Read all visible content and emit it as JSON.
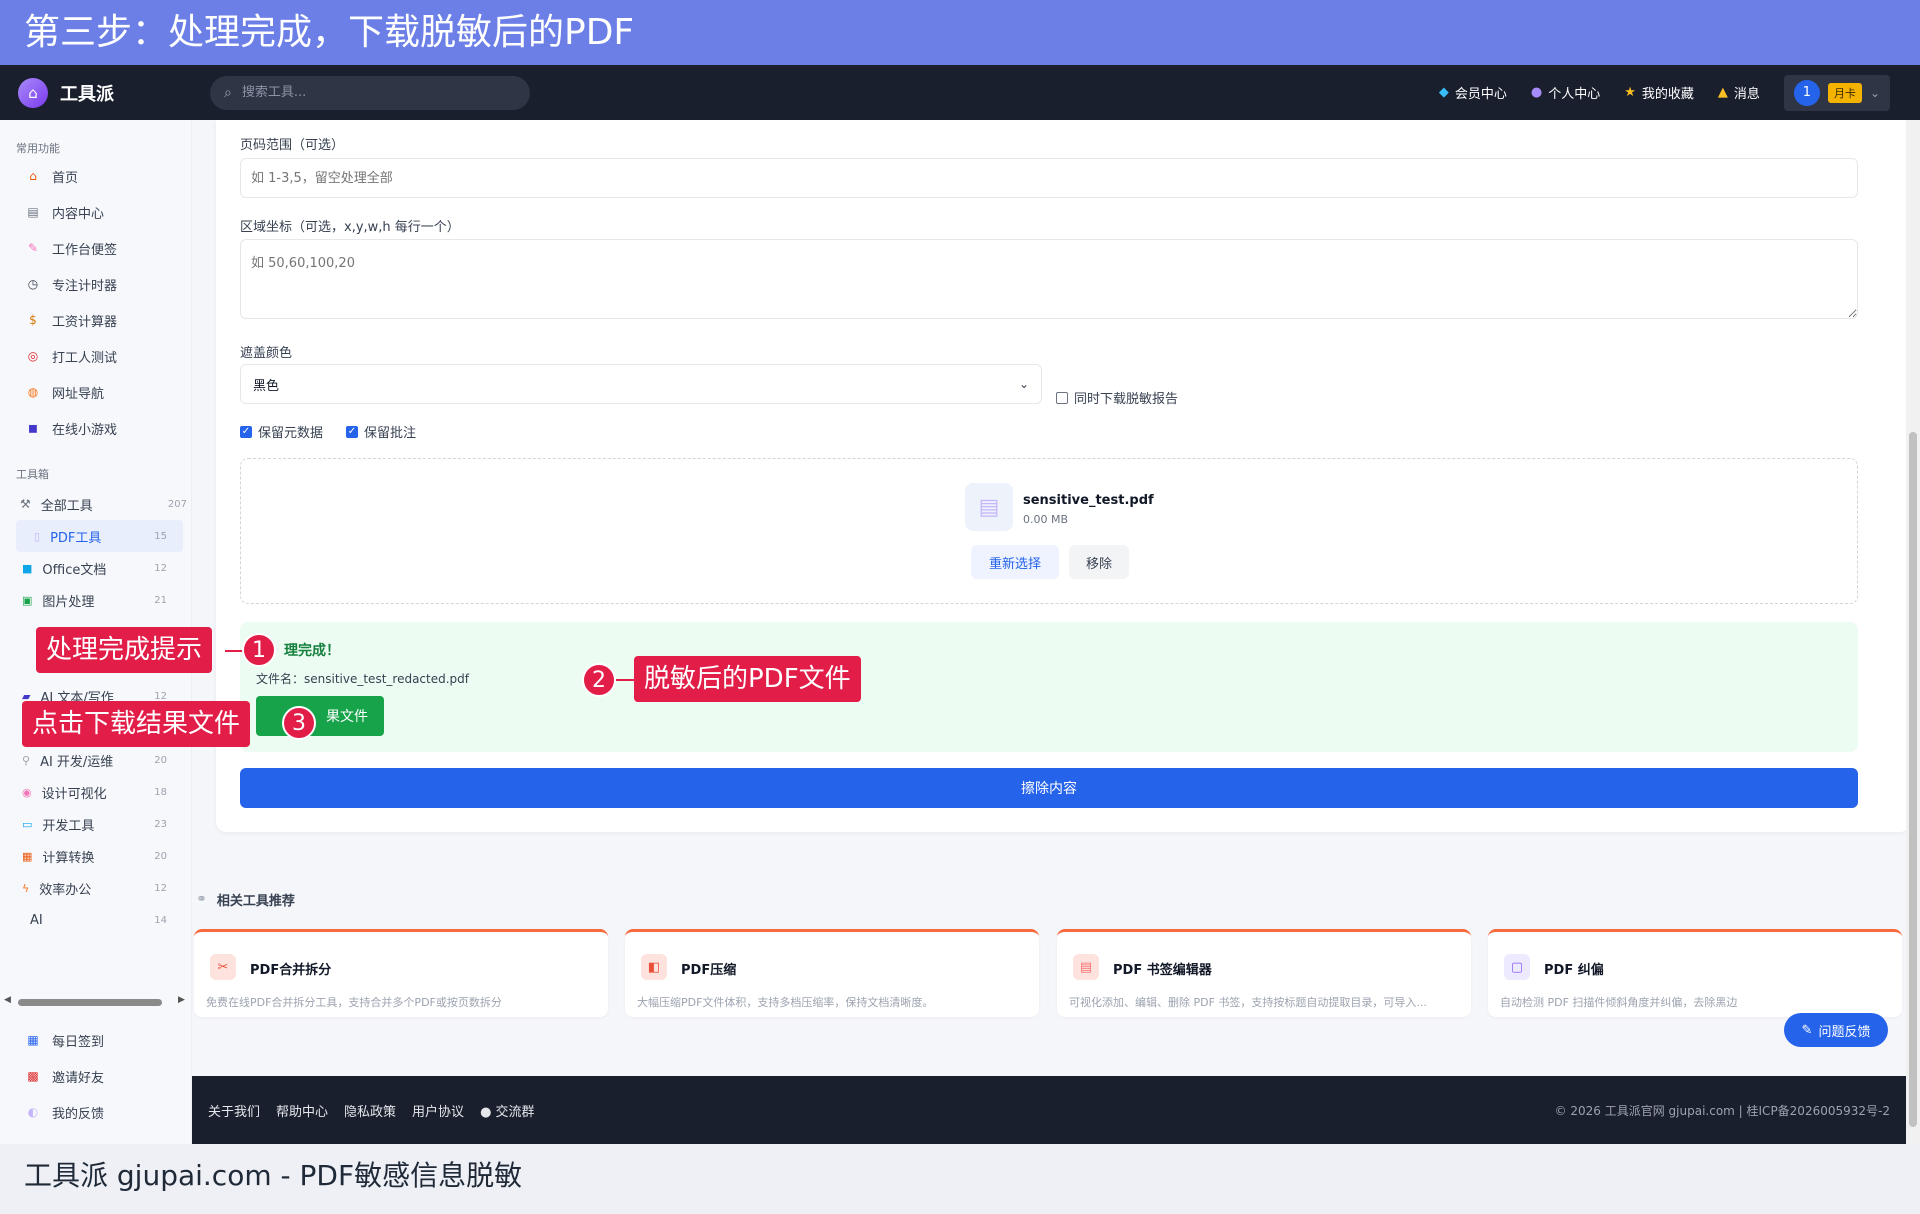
{
  "banner_top": "第三步：处理完成，下载脱敏后的PDF",
  "banner_bottom": "工具派 gjupai.com - PDF敏感信息脱敏",
  "header": {
    "logo_text": "工具派",
    "search_placeholder": "搜索工具...",
    "nav": [
      {
        "label": "会员中心",
        "icon": "diamond-icon"
      },
      {
        "label": "个人中心",
        "icon": "user-icon"
      },
      {
        "label": "我的收藏",
        "icon": "star-icon"
      },
      {
        "label": "消息",
        "icon": "bell-icon"
      }
    ],
    "user_avatar": "1",
    "member_badge": "月卡"
  },
  "sidebar": {
    "section_common": "常用功能",
    "common_items": [
      "首页",
      "内容中心",
      "工作台便签",
      "专注计时器",
      "工资计算器",
      "打工人测试",
      "网址导航",
      "在线小游戏"
    ],
    "section_tools": "工具箱",
    "all_tools": {
      "label": "全部工具",
      "count": "207"
    },
    "categories": [
      {
        "label": "PDF工具",
        "count": "15"
      },
      {
        "label": "Office文档",
        "count": "12"
      },
      {
        "label": "图片处理",
        "count": "21"
      },
      {
        "label": "AI 文本/写作",
        "count": "12"
      },
      {
        "label": "AI 开发/运维",
        "count": "20"
      },
      {
        "label": "设计可视化",
        "count": "18"
      },
      {
        "label": "开发工具",
        "count": "23"
      },
      {
        "label": "计算转换",
        "count": "20"
      },
      {
        "label": "效率办公",
        "count": "12"
      },
      {
        "label": "AI",
        "count": "14"
      }
    ],
    "bottom_items": [
      "每日签到",
      "邀请好友",
      "我的反馈"
    ]
  },
  "form": {
    "page_range_label": "页码范围（可选）",
    "page_range_placeholder": "如 1-3,5，留空处理全部",
    "area_label": "区域坐标（可选，x,y,w,h 每行一个）",
    "area_placeholder": "如 50,60,100,20",
    "color_label": "遮盖颜色",
    "color_value": "黑色",
    "report_label": "同时下载脱敏报告",
    "keep_meta_label": "保留元数据",
    "keep_annot_label": "保留批注"
  },
  "file": {
    "name": "sensitive_test.pdf",
    "size": "0.00 MB",
    "reselect": "重新选择",
    "remove": "移除"
  },
  "result": {
    "title": "理完成！",
    "filename": "文件名：sensitive_test_redacted.pdf",
    "download": "果文件"
  },
  "erase_button": "擦除内容",
  "related": {
    "title": "相关工具推荐",
    "cards": [
      {
        "title": "PDF合并拆分",
        "desc": "免费在线PDF合并拆分工具，支持合并多个PDF或按页数拆分",
        "color": "#e9503a"
      },
      {
        "title": "PDF压缩",
        "desc": "大幅压缩PDF文件体积，支持多档压缩率，保持文档清晰度。",
        "color": "#e9503a"
      },
      {
        "title": "PDF 书签编辑器",
        "desc": "可视化添加、编辑、删除 PDF 书签，支持按标题自动提取目录，可导入...",
        "color": "#f87171"
      },
      {
        "title": "PDF 纠偏",
        "desc": "自动检测 PDF 扫描件倾斜角度并纠偏，去除黑边",
        "color": "#8b5cf6"
      }
    ]
  },
  "feedback": "问题反馈",
  "footer": {
    "links": [
      "关于我们",
      "帮助中心",
      "隐私政策",
      "用户协议",
      "交流群"
    ],
    "copyright": "© 2026 工具派官网 gjupai.com | 桂ICP备2026005932号-2"
  },
  "annotations": [
    {
      "num": "1",
      "text": "处理完成提示"
    },
    {
      "num": "2",
      "text": "脱敏后的PDF文件"
    },
    {
      "num": "3",
      "text": "点击下载结果文件"
    }
  ]
}
